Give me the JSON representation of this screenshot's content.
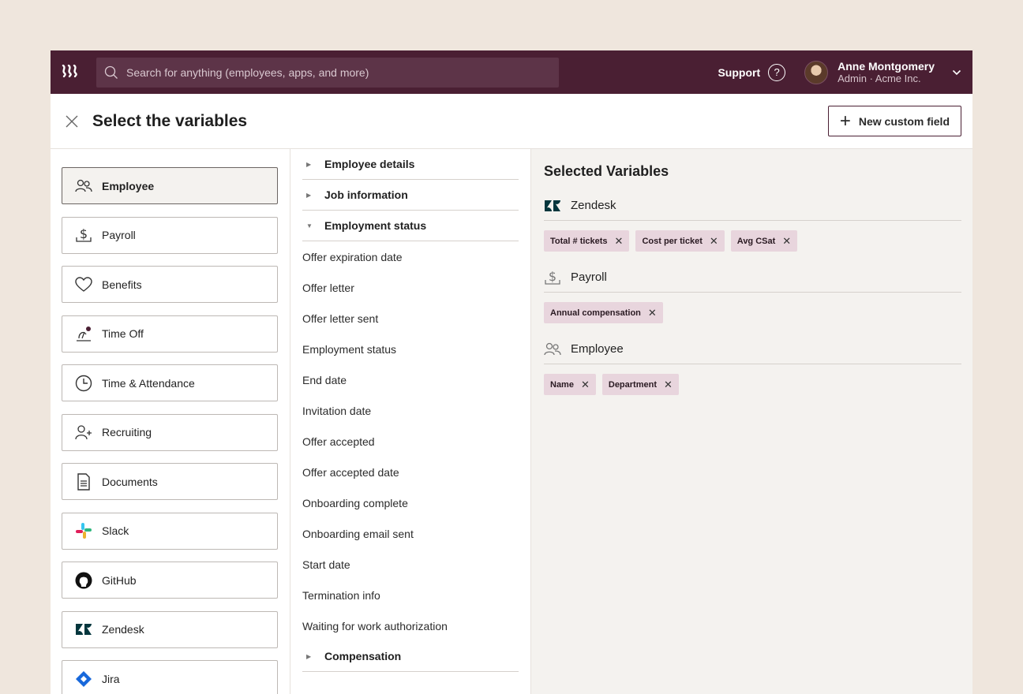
{
  "topbar": {
    "logo": "⌇⌇⌇",
    "search_placeholder": "Search for anything (employees, apps, and more)",
    "support_label": "Support",
    "user_name": "Anne Montgomery",
    "user_role": "Admin · Acme Inc."
  },
  "header": {
    "title": "Select the variables",
    "new_field_label": "New custom field"
  },
  "categories": [
    {
      "label": "Employee",
      "icon": "people-icon",
      "active": true
    },
    {
      "label": "Payroll",
      "icon": "dollar-icon"
    },
    {
      "label": "Benefits",
      "icon": "heart-icon"
    },
    {
      "label": "Time Off",
      "icon": "beach-icon"
    },
    {
      "label": "Time & Attendance",
      "icon": "clock-icon"
    },
    {
      "label": "Recruiting",
      "icon": "add-person-icon"
    },
    {
      "label": "Documents",
      "icon": "document-icon"
    },
    {
      "label": "Slack",
      "icon": "slack-icon"
    },
    {
      "label": "GitHub",
      "icon": "github-icon"
    },
    {
      "label": "Zendesk",
      "icon": "zendesk-icon"
    },
    {
      "label": "Jira",
      "icon": "jira-icon"
    }
  ],
  "fields": {
    "groups": {
      "employee_details": "Employee details",
      "job_information": "Job information",
      "employment_status": "Employment status",
      "compensation": "Compensation"
    },
    "items": [
      "Offer expiration date",
      "Offer letter",
      "Offer letter sent",
      "Employment status",
      "End date",
      "Invitation date",
      "Offer accepted",
      "Offer accepted date",
      "Onboarding complete",
      "Onboarding email sent",
      "Start date",
      "Termination info",
      "Waiting for work authorization"
    ]
  },
  "selected": {
    "title": "Selected Variables",
    "groups": [
      {
        "name": "Zendesk",
        "icon": "zendesk-icon",
        "chips": [
          "Total # tickets",
          "Cost per ticket",
          "Avg CSat"
        ]
      },
      {
        "name": "Payroll",
        "icon": "dollar-icon",
        "chips": [
          "Annual compensation"
        ]
      },
      {
        "name": "Employee",
        "icon": "people-icon",
        "chips": [
          "Name",
          "Department"
        ]
      }
    ]
  },
  "colors": {
    "topbar": "#4a1f33",
    "chip": "#e8d5dd",
    "page_bg": "#efe6dd"
  }
}
